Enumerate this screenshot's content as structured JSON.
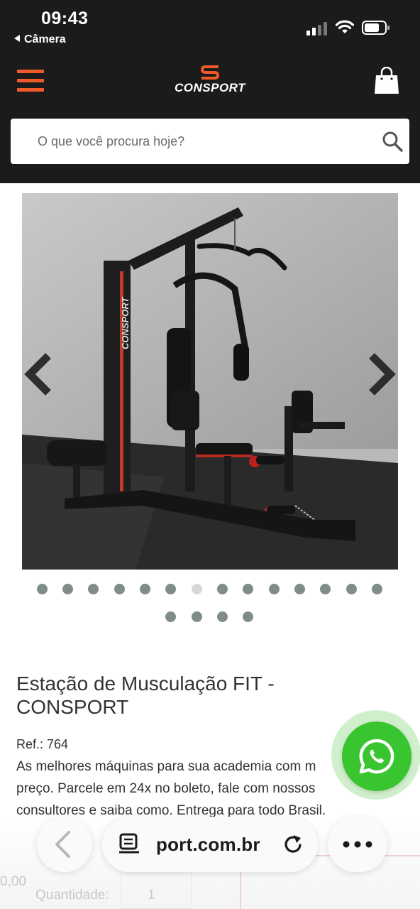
{
  "status_bar": {
    "time": "09:43",
    "back_app": "Câmera"
  },
  "header": {
    "brand": "CONSPORT",
    "menu_icon": "hamburger-menu-icon",
    "cart_icon": "shopping-bag-icon",
    "accent_color": "#ef5a28"
  },
  "search": {
    "placeholder": "O que você procura hoje?",
    "value": ""
  },
  "gallery": {
    "image_subject": "Estação de musculação CONSPORT",
    "prev_icon": "chevron-left-icon",
    "next_icon": "chevron-right-icon",
    "dot_count": 18,
    "active_dot": 7
  },
  "product": {
    "title_line1": "Estação de Musculação FIT -",
    "title_line2": "CONSPORT",
    "ref": "Ref.: 764",
    "desc_line1": "As melhores máquinas para sua academia com m",
    "desc_line2": "preço. Parcele em 24x no boleto, fale com nossos",
    "desc_line3": "consultores e saiba como. Entrega para todo Brasil."
  },
  "below_fold": {
    "price_partial": "0,00",
    "quantity_label": "Quantidade:",
    "quantity_value": "1"
  },
  "whatsapp": {
    "icon": "whatsapp-icon",
    "color": "#39c52f"
  },
  "browser": {
    "url": "port.com.br",
    "reader_icon": "reader-view-icon",
    "reload_icon": "reload-icon",
    "more_icon": "more-options-icon"
  }
}
